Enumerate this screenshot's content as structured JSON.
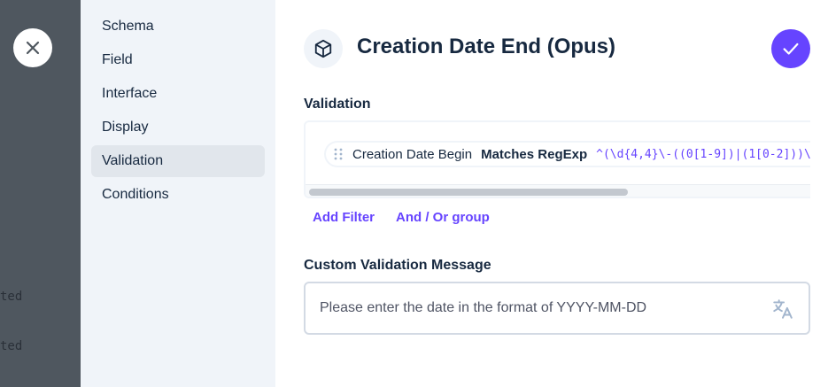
{
  "backdrop": {
    "lines": [
      "ted",
      "ted"
    ]
  },
  "sidebar": {
    "items": [
      {
        "label": "Schema"
      },
      {
        "label": "Field"
      },
      {
        "label": "Interface"
      },
      {
        "label": "Display"
      },
      {
        "label": "Validation",
        "active": true
      },
      {
        "label": "Conditions"
      }
    ]
  },
  "header": {
    "icon": "cube-icon",
    "title": "Creation Date End (Opus)"
  },
  "validation": {
    "label": "Validation",
    "filter": {
      "field": "Creation Date Begin",
      "operator": "Matches RegExp",
      "value": "^(\\d{4,4}\\-((0[1-9])|(1[0-2]))\\-"
    },
    "add_filter": "Add Filter",
    "and_or_group": "And / Or group"
  },
  "custom_message": {
    "label": "Custom Validation Message",
    "value": "Please enter the date in the format of YYYY-MM-DD"
  },
  "colors": {
    "accent": "#6644ff",
    "backdrop": "#4f575f",
    "sidebar": "#f0f4f9"
  }
}
